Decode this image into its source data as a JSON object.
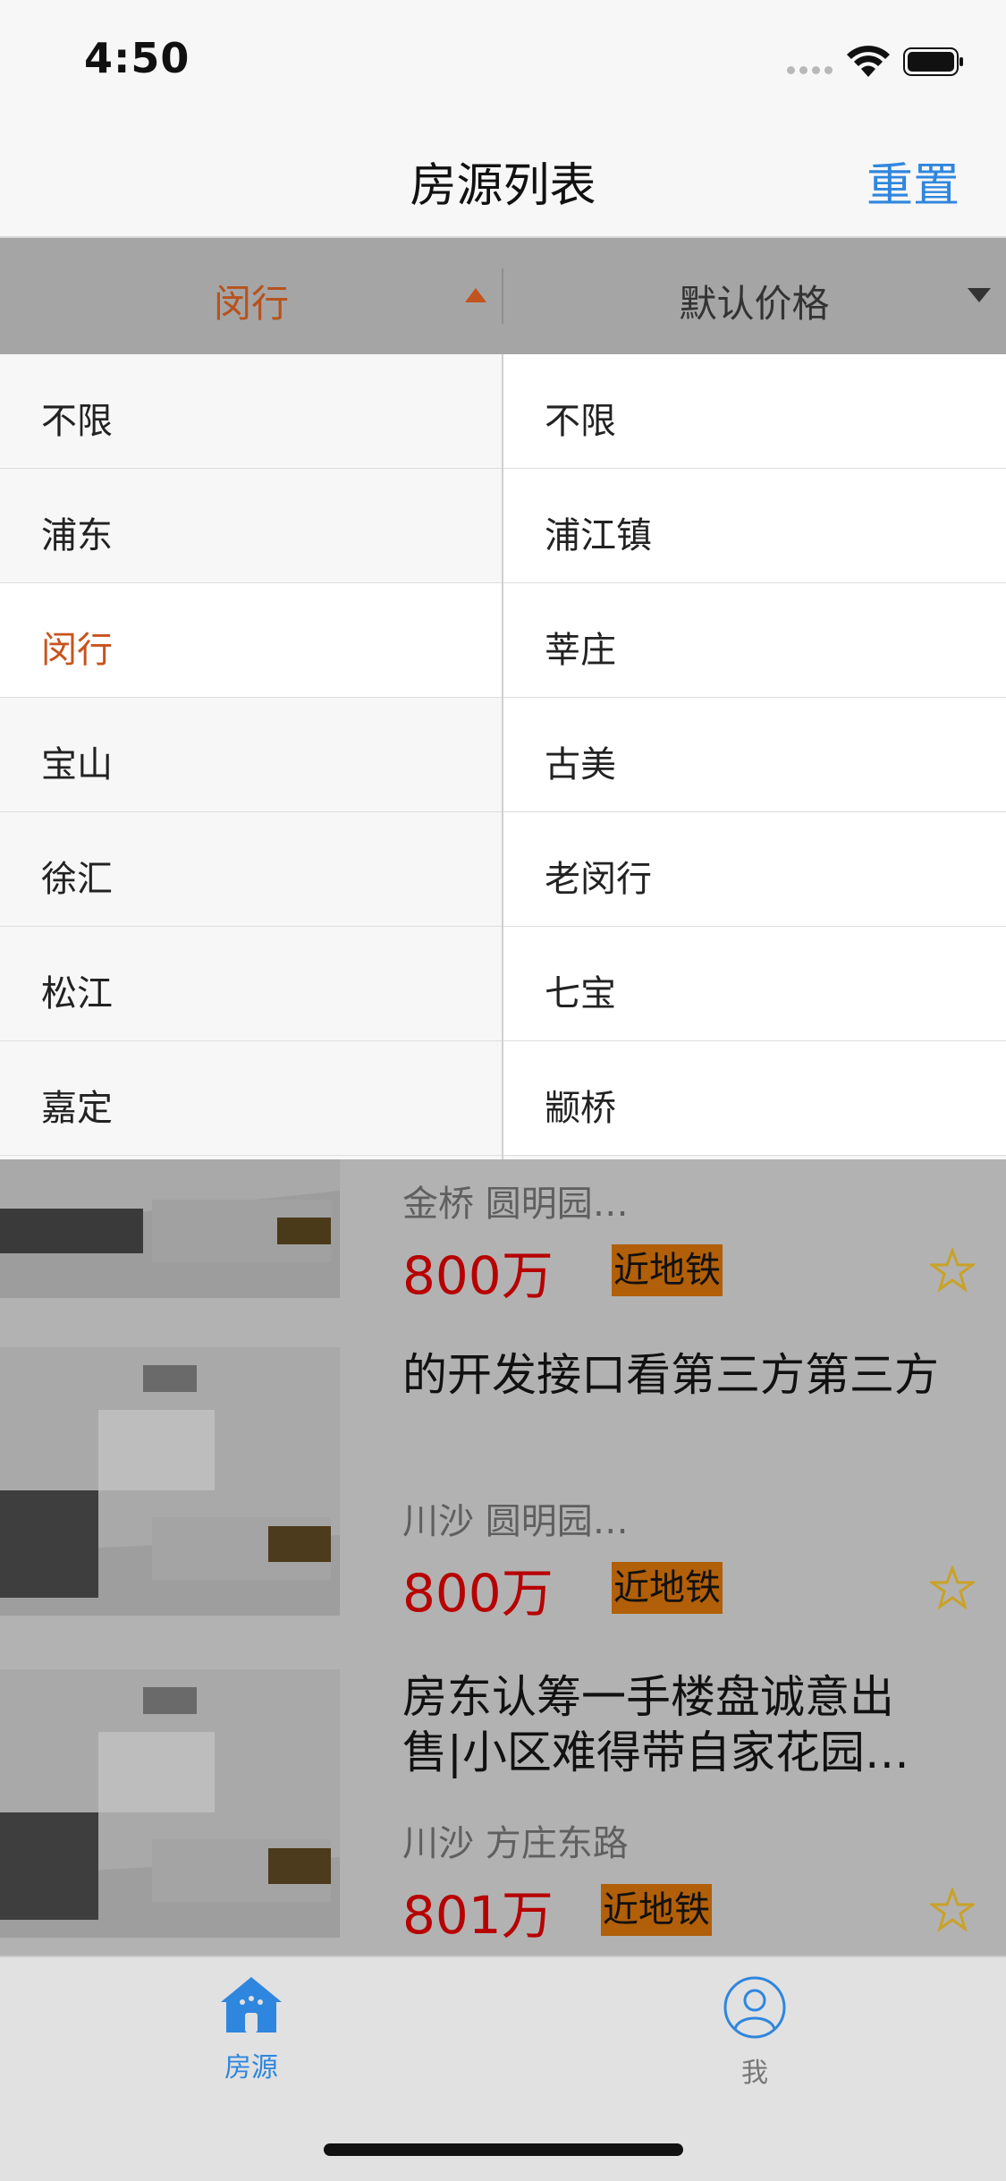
{
  "status": {
    "time": "4:50"
  },
  "nav": {
    "title": "房源列表",
    "reset_label": "重置"
  },
  "filter": {
    "left_label": "闵行",
    "right_label": "默认价格"
  },
  "dropdown": {
    "districts": [
      "不限",
      "浦东",
      "闵行",
      "宝山",
      "徐汇",
      "松江",
      "嘉定"
    ],
    "selected_district": "闵行",
    "areas": [
      "不限",
      "浦江镇",
      "莘庄",
      "古美",
      "老闵行",
      "七宝",
      "颛桥"
    ]
  },
  "listings": [
    {
      "title": "",
      "location": "金桥   圆明园…",
      "price": "800万",
      "badge": "近地铁"
    },
    {
      "title": "的开发接口看第三方第三方",
      "location": "川沙   圆明园…",
      "price": "800万",
      "badge": "近地铁"
    },
    {
      "title": "房东认筹一手楼盘诚意出售|小区难得带自家花园…",
      "location": "川沙   方庄东路",
      "price": "801万",
      "badge": "近地铁"
    }
  ],
  "tabbar": {
    "tabs": [
      {
        "label": "房源",
        "icon": "house-icon",
        "active": true
      },
      {
        "label": "我",
        "icon": "person-icon",
        "active": false
      }
    ]
  },
  "colors": {
    "accent_blue": "#2f86de",
    "selected_orange": "#c9531c",
    "price_red": "#b70000",
    "badge_orange": "#b15f08"
  }
}
